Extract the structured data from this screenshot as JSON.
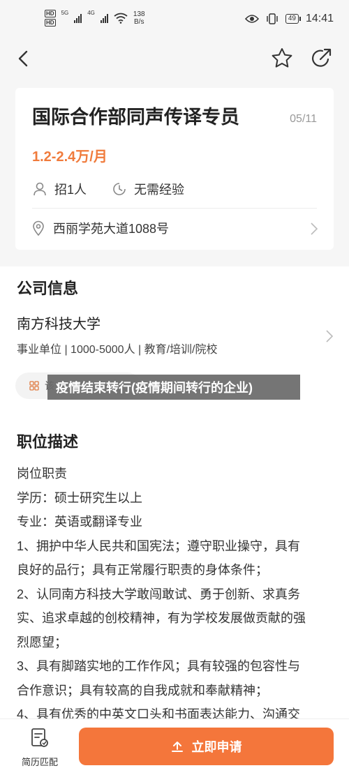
{
  "status_bar": {
    "hd1": "HD",
    "hd2": "HD",
    "sig1": "5G",
    "sig2": "4G",
    "speed_value": "138",
    "speed_unit": "B/s",
    "battery": "49",
    "time": "14:41"
  },
  "job": {
    "title": "国际合作部同声传译专员",
    "date": "05/11",
    "salary": "1.2-2.4万/月",
    "headcount": "招1人",
    "experience": "无需经验",
    "address": "西丽学苑大道1088号"
  },
  "company": {
    "section_title": "公司信息",
    "name": "南方科技大学",
    "info": "事业单位 | 1000-5000人 | 教育/培训/院校",
    "chip_label": "该"
  },
  "banner": {
    "text": "疫情结束转行(疫情期间转行的企业)"
  },
  "description": {
    "section_title": "职位描述",
    "lines": [
      "岗位职责",
      "学历：硕士研究生以上",
      "专业：英语或翻译专业",
      "1、拥护中华人民共和国宪法；遵守职业操守，具有",
      "良好的品行；具有正常履行职责的身体条件；",
      "2、认同南方科技大学敢闯敢试、勇于创新、求真务",
      "实、追求卓越的创校精神，有为学校发展做贡献的强",
      "烈愿望；",
      "3、具有脚踏实地的工作作风；具有较强的包容性与",
      "合作意识；具有较高的自我成就和奉献精神；",
      "4、具有优秀的中英文口头和书面表达能力、沟通交"
    ]
  },
  "bottom": {
    "resume_label": "简历匹配",
    "apply_label": "立即申请"
  },
  "colors": {
    "accent": "#f4763b",
    "salary": "#f07b3c"
  },
  "icons": {
    "back": "chevron-left-icon",
    "star": "star-icon",
    "share": "share-icon",
    "person": "person-icon",
    "clock": "clock-icon",
    "location": "location-pin-icon",
    "resume": "resume-icon",
    "apply": "upload-icon"
  }
}
